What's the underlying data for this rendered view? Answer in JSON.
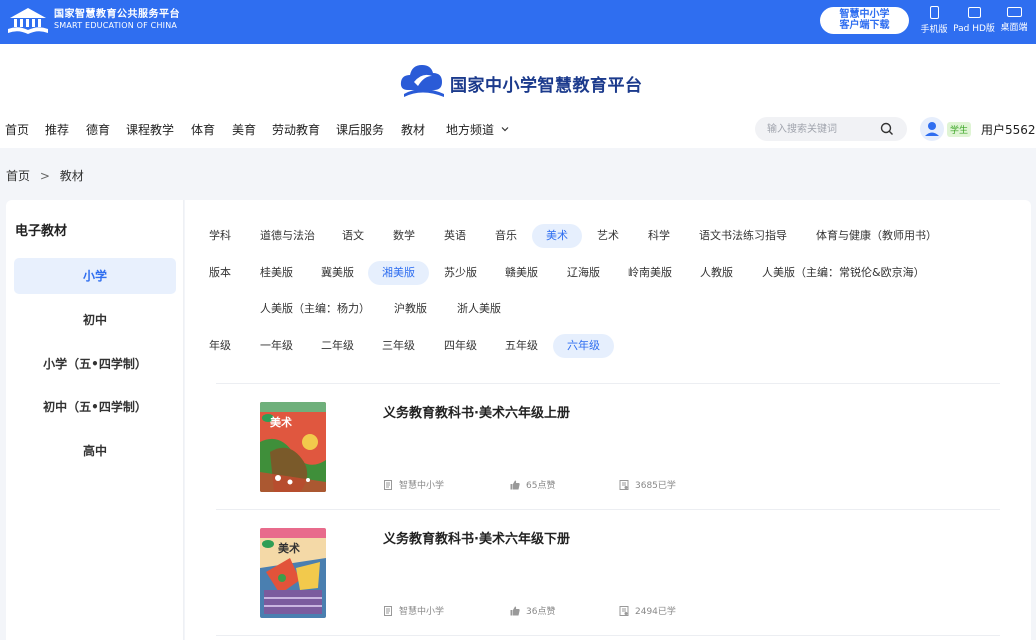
{
  "topbar": {
    "brand_cn": "国家智慧教育公共服务平台",
    "brand_en": "SMART EDUCATION OF CHINA",
    "client_line1": "智慧中小学",
    "client_line2": "客户端下载",
    "devices": [
      {
        "label": "手机版",
        "icon": "phone-icon"
      },
      {
        "label": "Pad HD版",
        "icon": "tablet-icon"
      },
      {
        "label": "桌面端",
        "icon": "desktop-icon"
      }
    ],
    "color": "#2f6ef0"
  },
  "header": {
    "title": "国家中小学智慧教育平台",
    "nav": [
      "首页",
      "推荐",
      "德育",
      "课程教学",
      "体育",
      "美育",
      "劳动教育",
      "课后服务",
      "教材",
      "地方频道"
    ],
    "search_placeholder": "输入搜索关键词",
    "role": "学生",
    "username": "用户5562"
  },
  "breadcrumb": {
    "home": "首页",
    "separator": ">",
    "current": "教材"
  },
  "sidebar": {
    "title": "电子教材",
    "items": [
      "小学",
      "初中",
      "小学（五•四学制）",
      "初中（五•四学制）",
      "高中"
    ],
    "active_index": 0
  },
  "filters": {
    "subject": {
      "label": "学科",
      "options": [
        "道德与法治",
        "语文",
        "数学",
        "英语",
        "音乐",
        "美术",
        "艺术",
        "科学",
        "语文书法练习指导",
        "体育与健康（教师用书）"
      ],
      "active": "美术"
    },
    "edition": {
      "label": "版本",
      "options": [
        "桂美版",
        "冀美版",
        "湘美版",
        "苏少版",
        "赣美版",
        "辽海版",
        "岭南美版",
        "人教版",
        "人美版（主编：常锐伦&欧京海）",
        "人美版（主编：杨力）",
        "沪教版",
        "浙人美版"
      ],
      "active": "湘美版"
    },
    "grade": {
      "label": "年级",
      "options": [
        "一年级",
        "二年级",
        "三年级",
        "四年级",
        "五年级",
        "六年级"
      ],
      "active": "六年级"
    }
  },
  "books": [
    {
      "title": "义务教育教科书·美术六年级上册",
      "source": "智慧中小学",
      "likes": "65点赞",
      "learners": "3685已学",
      "cover_label": "美术"
    },
    {
      "title": "义务教育教科书·美术六年级下册",
      "source": "智慧中小学",
      "likes": "36点赞",
      "learners": "2494已学",
      "cover_label": "美术"
    }
  ]
}
